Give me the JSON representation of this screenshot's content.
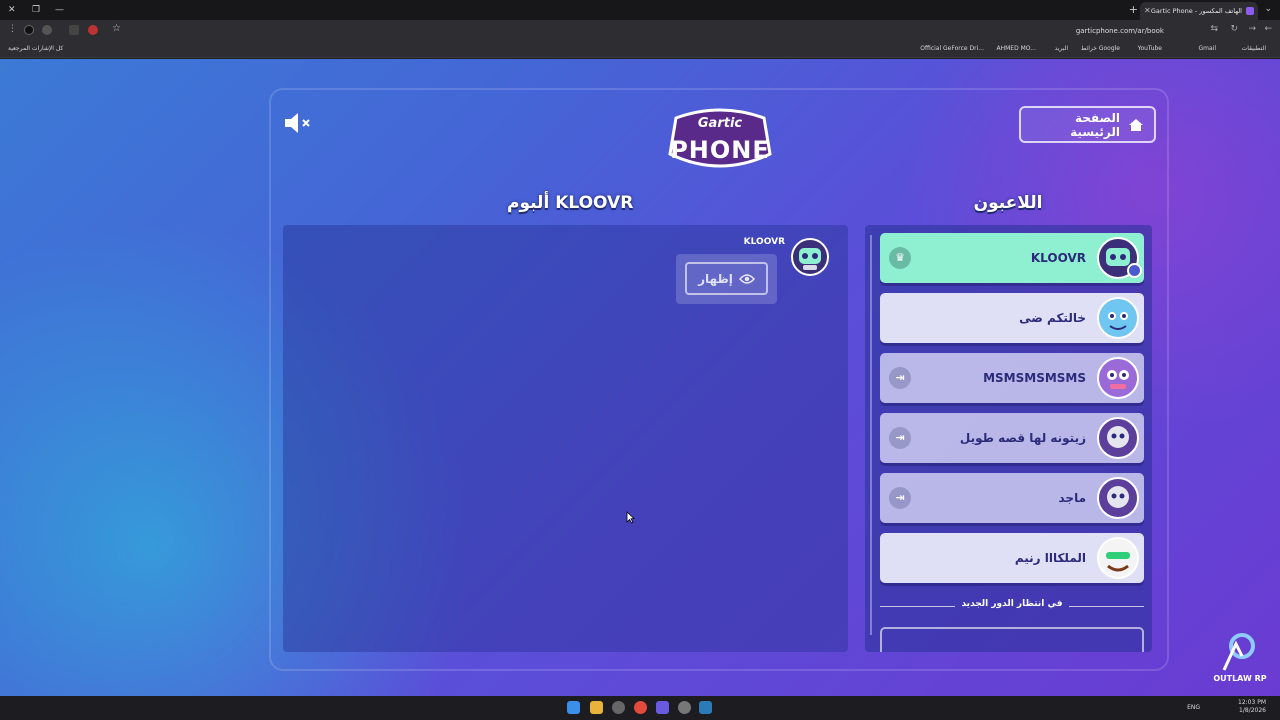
{
  "browser": {
    "tab_title": "الهاتف المكسور - Gartic Phone",
    "url": "garticphone.com/ar/book",
    "bookmarks": [
      "التطبيقات",
      "Gmail",
      "YouTube",
      "خرائط Google",
      "البريد",
      "AHMED MO...",
      "Official GeForce Dri..."
    ],
    "all_bookmarks": "كل الإشارات المرجعية"
  },
  "header": {
    "logo_top": "Gartic",
    "logo_bottom": "PHONE",
    "home_label": "الصفحة الرئيسية"
  },
  "album": {
    "title": "ألبوم KLOOVR",
    "author": "KLOOVR",
    "show_label": "إظهار"
  },
  "players": {
    "title": "اللاعبون",
    "list": [
      {
        "name": "KLOOVR",
        "state": "host"
      },
      {
        "name": "خالتكم ضى",
        "state": "active"
      },
      {
        "name": "MSMSMSMSMS",
        "state": "waiting"
      },
      {
        "name": "زيتونه لها قصه طويل",
        "state": "waiting"
      },
      {
        "name": "ماجد",
        "state": "waiting"
      },
      {
        "name": "الملكااا رنيم",
        "state": "active"
      }
    ],
    "waiting_label": "في انتظار الدور الجديد"
  },
  "watermark": {
    "text": "OUTLAW RP"
  },
  "taskbar": {
    "lang": "ENG",
    "time": "12:03 PM",
    "date": "1/8/2026"
  },
  "colors": {
    "host_row": "#8ef0d1",
    "row": "#dfe0f6",
    "player_text": "#2c2a7a"
  }
}
